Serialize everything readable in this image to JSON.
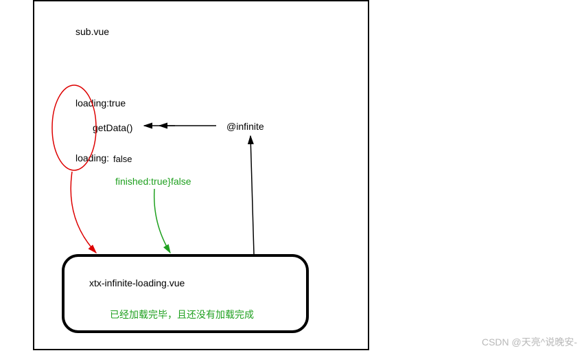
{
  "labels": {
    "parent_file": "sub.vue",
    "loading_true": "loading:true",
    "get_data": "getData()",
    "infinite_event": "@infinite",
    "loading_false": "loading:",
    "loading_false_val": "false",
    "finished": "finished:true}false",
    "child_file": "xtx-infinite-loading.vue",
    "status_text": "已经加载完毕，且还没有加载完成"
  },
  "watermark": "CSDN @天亮^说晚安-"
}
